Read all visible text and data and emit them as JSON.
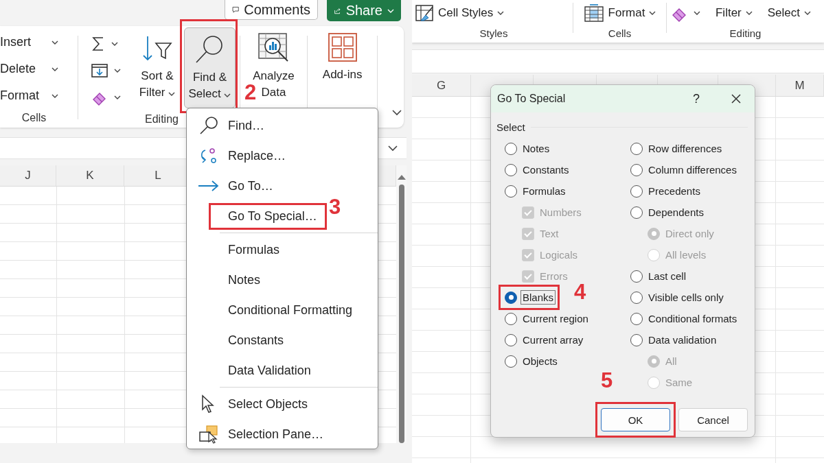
{
  "left_screen": {
    "header_buttons": [
      {
        "label": "Comments",
        "kind": "comments"
      },
      {
        "label": "Share",
        "kind": "share"
      }
    ],
    "cells_group": {
      "label": "Cells",
      "commands": [
        {
          "label": "Insert"
        },
        {
          "label": "Delete"
        },
        {
          "label": "Format"
        }
      ]
    },
    "editing_group": {
      "label": "Editing",
      "buttons": [
        {
          "label": "Sort & Filter",
          "kind": "sort",
          "pressed": false,
          "highlighted": false
        },
        {
          "label": "Find & Select",
          "kind": "find",
          "pressed": true,
          "highlighted": true,
          "step": "2"
        }
      ]
    },
    "large_buttons": [
      {
        "label": "Analyze Data",
        "kind": "analyze"
      },
      {
        "label": "Add-ins",
        "kind": "addins"
      }
    ],
    "columns": [
      "J",
      "K",
      "L"
    ],
    "menu": {
      "sections": [
        [
          {
            "label": "Find…",
            "highlighted": false
          },
          {
            "label": "Replace…",
            "highlighted": false
          },
          {
            "label": "Go To…",
            "highlighted": false
          },
          {
            "label": "Go To Special…",
            "highlighted": true,
            "step": "3"
          }
        ],
        [
          {
            "label": "Formulas",
            "highlighted": false
          },
          {
            "label": "Notes",
            "highlighted": false
          },
          {
            "label": "Conditional Formatting",
            "highlighted": false
          },
          {
            "label": "Constants",
            "highlighted": false
          },
          {
            "label": "Data Validation",
            "highlighted": false
          }
        ],
        [
          {
            "label": "Select Objects",
            "highlighted": false
          },
          {
            "label": "Selection Pane…",
            "highlighted": false
          }
        ]
      ]
    }
  },
  "right_screen": {
    "ribbon_groups": [
      {
        "label": "Styles",
        "commands": [
          {
            "label": "Cell Styles"
          }
        ]
      },
      {
        "label": "Cells",
        "commands": [
          {
            "label": "Format"
          }
        ]
      },
      {
        "label": "Editing",
        "commands": [
          {
            "kind": "icon"
          },
          {
            "label": "Filter",
            "kind": "text"
          },
          {
            "label": "Select",
            "kind": "text"
          }
        ]
      }
    ],
    "columns": [
      "G",
      "M"
    ],
    "dialog": {
      "title": "Go To Special",
      "help": "?",
      "group_label": "Select",
      "columns": [
        [
          {
            "label": "Notes",
            "kind": "radio",
            "selected": false,
            "highlighted": false
          },
          {
            "label": "Constants",
            "kind": "radio",
            "selected": false,
            "highlighted": false
          },
          {
            "label": "Formulas",
            "kind": "radio",
            "selected": false,
            "highlighted": false,
            "children": [
              {
                "label": "Numbers",
                "kind": "checkbox",
                "checked": true,
                "disabled": true
              },
              {
                "label": "Text",
                "kind": "checkbox",
                "checked": true,
                "disabled": true
              },
              {
                "label": "Logicals",
                "kind": "checkbox",
                "checked": true,
                "disabled": true
              },
              {
                "label": "Errors",
                "kind": "checkbox",
                "checked": true,
                "disabled": true
              }
            ]
          },
          {
            "label": "Blanks",
            "kind": "radio",
            "selected": true,
            "highlighted": true,
            "step": "4"
          },
          {
            "label": "Current region",
            "kind": "radio",
            "selected": false,
            "highlighted": false
          },
          {
            "label": "Current array",
            "kind": "radio",
            "selected": false,
            "highlighted": false
          },
          {
            "label": "Objects",
            "kind": "radio",
            "selected": false,
            "highlighted": false
          }
        ],
        [
          {
            "label": "Row differences",
            "kind": "radio",
            "selected": false,
            "highlighted": false
          },
          {
            "label": "Column differences",
            "kind": "radio",
            "selected": false,
            "highlighted": false
          },
          {
            "label": "Precedents",
            "kind": "radio",
            "selected": false,
            "highlighted": false
          },
          {
            "label": "Dependents",
            "kind": "radio",
            "selected": false,
            "highlighted": false,
            "children": [
              {
                "label": "Direct only",
                "kind": "radio",
                "selected": true,
                "disabled": true
              },
              {
                "label": "All levels",
                "kind": "radio",
                "selected": false,
                "disabled": true
              }
            ]
          },
          {
            "label": "Last cell",
            "kind": "radio",
            "selected": false,
            "highlighted": false
          },
          {
            "label": "Visible cells only",
            "kind": "radio",
            "selected": false,
            "highlighted": false
          },
          {
            "label": "Conditional formats",
            "kind": "radio",
            "selected": false,
            "highlighted": false
          },
          {
            "label": "Data validation",
            "kind": "radio",
            "selected": false,
            "highlighted": false,
            "children": [
              {
                "label": "All",
                "kind": "radio",
                "selected": true,
                "disabled": true
              },
              {
                "label": "Same",
                "kind": "radio",
                "selected": false,
                "disabled": true
              }
            ]
          }
        ]
      ],
      "buttons": [
        {
          "label": "OK",
          "default": true,
          "highlighted": true,
          "step": "5"
        },
        {
          "label": "Cancel",
          "default": false,
          "highlighted": false
        }
      ]
    }
  }
}
